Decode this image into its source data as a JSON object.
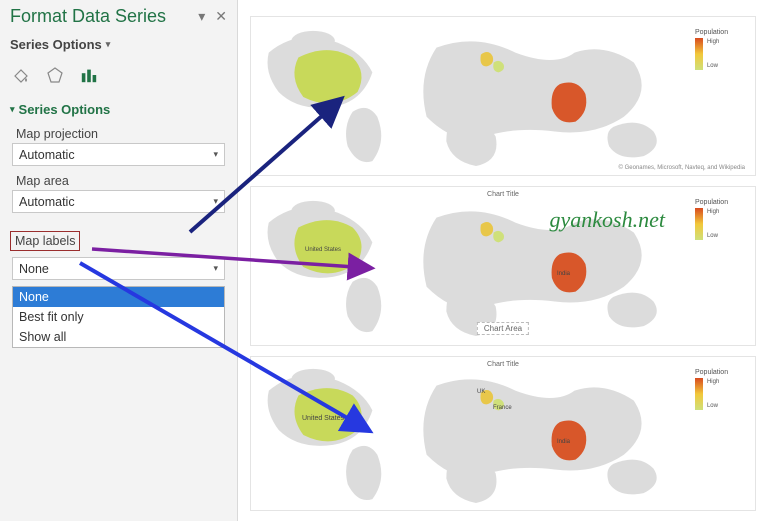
{
  "pane": {
    "title": "Format Data Series",
    "dropdown_icon": "▾",
    "close_icon": "✕",
    "series_switch": "Series Options",
    "section_head": "Series Options",
    "labels": {
      "projection": "Map projection",
      "area": "Map area",
      "labels": "Map labels"
    },
    "projection_value": "Automatic",
    "area_value": "Automatic",
    "labels_value": "None",
    "labels_options": [
      "None",
      "Best fit only",
      "Show all"
    ]
  },
  "maps": {
    "legend_title": "Population",
    "legend_ticks": [
      "High",
      "Low"
    ],
    "attribution": "© Geonames, Microsoft, Navteq, and Wikipedia",
    "countries": {
      "us": "United States",
      "uk": "UK",
      "fr": "France",
      "india": "India"
    },
    "map2": {
      "chart_title": "Chart Area",
      "us_label": "United States",
      "india_label": "India"
    },
    "map3": {
      "chart_title": "Chart Title",
      "us_label": "United States",
      "uk_label": "UK",
      "fr_label": "France",
      "india_label": "India"
    }
  },
  "watermark": "gyankosh.net"
}
